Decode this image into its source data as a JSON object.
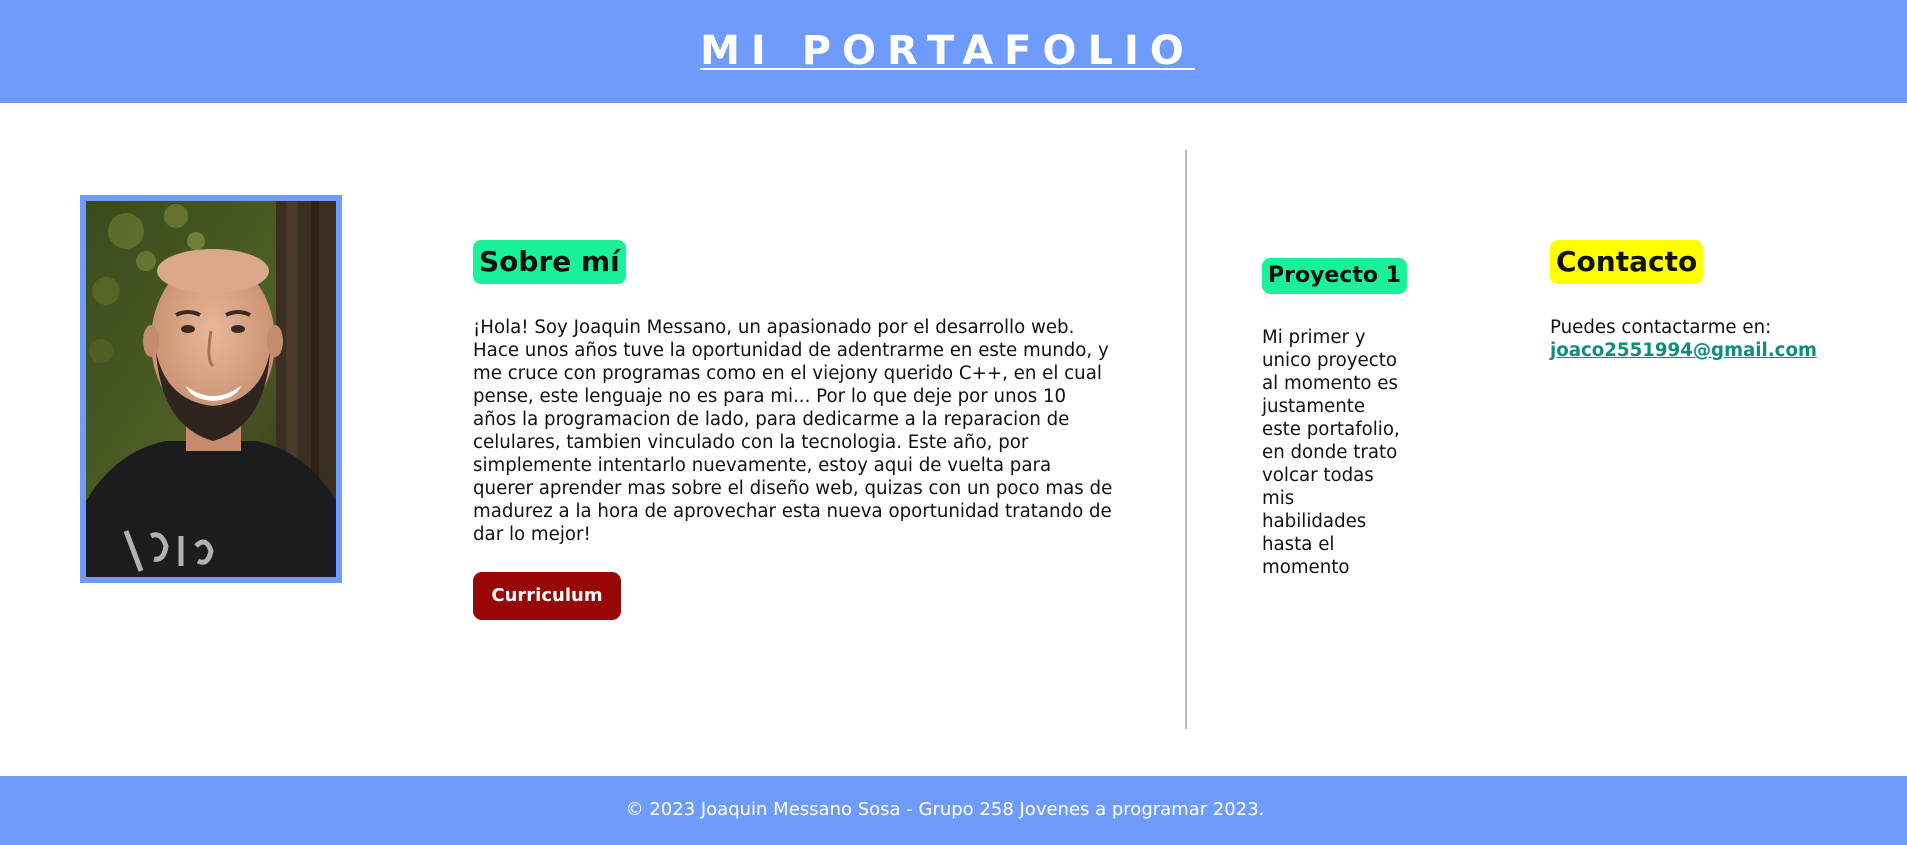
{
  "header": {
    "title": "MI PORTAFOLIO"
  },
  "about": {
    "heading": "Sobre mí",
    "text": "¡Hola! Soy Joaquin Messano, un apasionado por el desarrollo web. Hace unos años tuve la oportunidad de adentrarme en este mundo, y me cruce con programas como en el viejony querido C++, en el cual pense, este lenguaje no es para mi... Por lo que deje por unos 10 años la programacion de lado, para dedicarme a la reparacion de celulares, tambien vinculado con la tecnologia. Este año, por simplemente intentarlo nuevamente, estoy aqui de vuelta para querer aprender mas sobre el diseño web, quizas con un poco mas de madurez a la hora de aprovechar esta nueva oportunidad tratando de dar lo mejor!",
    "button_label": "Curriculum"
  },
  "project": {
    "heading": "Proyecto 1",
    "text": "Mi primer y unico proyecto al momento es justamente este portafolio, en donde trato volcar todas mis habilidades hasta el momento"
  },
  "contact": {
    "heading": "Contacto",
    "intro": "Puedes contactarme en:",
    "email": "joaco2551994@gmail.com"
  },
  "footer": {
    "text": "© 2023 Joaquin Messano Sosa - Grupo 258 Jovenes a programar 2023."
  },
  "colors": {
    "header_bg": "#6f9cfc",
    "about_heading_bg": "#1af29a",
    "contact_heading_bg": "#ffff00",
    "button_bg": "#990606",
    "email_link": "#0f8f78"
  }
}
